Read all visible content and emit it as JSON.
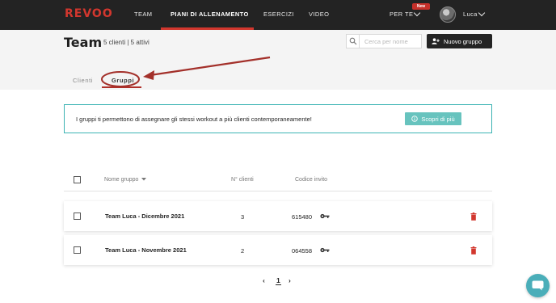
{
  "brand": {
    "logo_text": "REVOO",
    "accent": "#d2372e"
  },
  "topnav": {
    "items": [
      {
        "label": "TEAM",
        "active": false
      },
      {
        "label": "PIANI DI ALLENAMENTO",
        "active": true
      },
      {
        "label": "ESERCIZI",
        "active": false
      },
      {
        "label": "VIDEO",
        "active": false
      }
    ],
    "for_you": {
      "label": "PER TE",
      "badge": "New"
    },
    "user": {
      "name": "Luca"
    }
  },
  "header": {
    "title": "Team",
    "counts": "5 clienti | 5 attivi",
    "search_placeholder": "Cerca per nome",
    "new_group_label": "Nuovo gruppo"
  },
  "tabs": [
    {
      "label": "Clienti",
      "active": false
    },
    {
      "label": "Gruppi",
      "active": true
    }
  ],
  "info_banner": {
    "text": "I gruppi ti permettono di assegnare gli stessi workout a più clienti contemporaneamente!",
    "button_label": "Scopri di più",
    "color": "#3db4b4"
  },
  "table": {
    "columns": [
      "Nome gruppo",
      "N° clienti",
      "Codice invito"
    ],
    "rows": [
      {
        "name": "Team Luca - Dicembre 2021",
        "clients": "3",
        "code": "615480"
      },
      {
        "name": "Team Luca - Novembre 2021",
        "clients": "2",
        "code": "064558"
      }
    ]
  },
  "pagination": {
    "prev": "‹",
    "current": "1",
    "next": "›"
  },
  "icons": [
    "search-icon",
    "add-user-icon",
    "info-icon",
    "key-icon",
    "trash-icon",
    "chat-icon",
    "chevron-down-icon",
    "sort-caret-icon"
  ],
  "annotation_color": "#a3302a"
}
